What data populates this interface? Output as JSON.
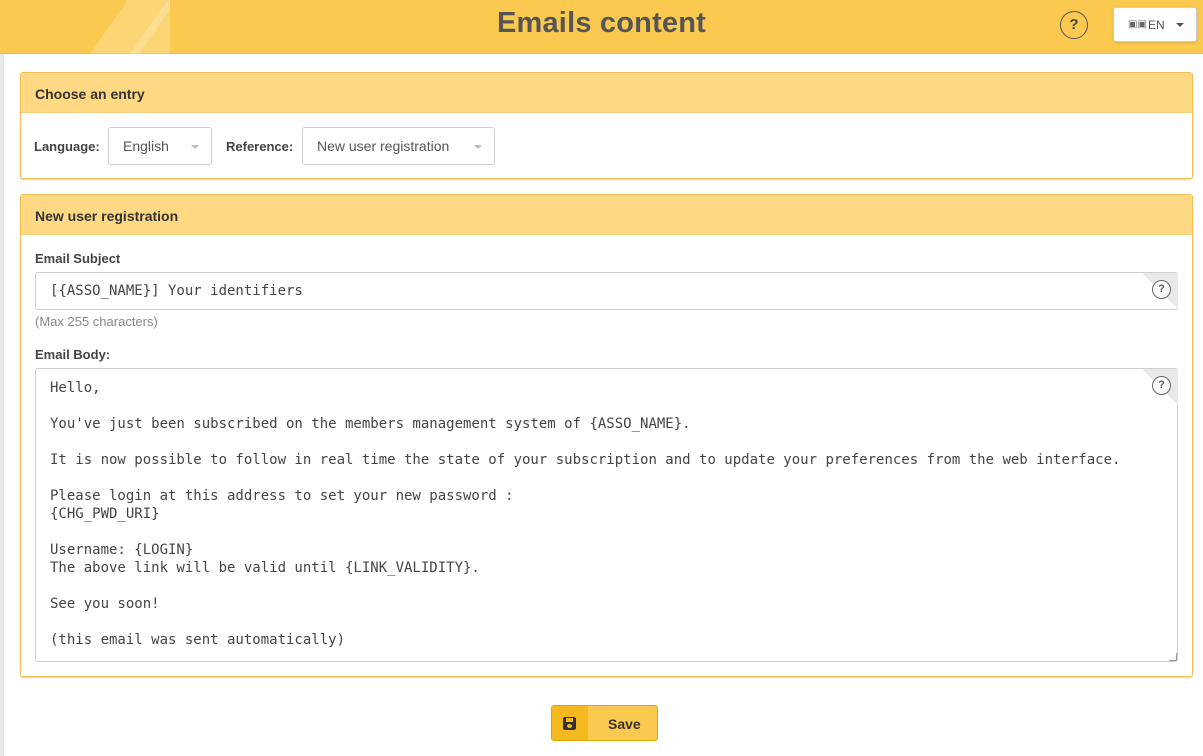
{
  "header": {
    "title": "Emails content",
    "help_label": "?",
    "language_switch": {
      "flag_icon": "flag-icon",
      "code": "EN"
    }
  },
  "choose_entry": {
    "title": "Choose an entry",
    "language_label": "Language:",
    "language_value": "English",
    "reference_label": "Reference:",
    "reference_value": "New user registration"
  },
  "editor": {
    "title": "New user registration",
    "subject_label": "Email Subject",
    "subject_value": "[{ASSO_NAME}] Your identifiers",
    "subject_hint": "(Max 255 characters)",
    "body_label": "Email Body:",
    "body_value": "Hello,\n\nYou've just been subscribed on the members management system of {ASSO_NAME}.\n\nIt is now possible to follow in real time the state of your subscription and to update your preferences from the web interface.\n\nPlease login at this address to set your new password :\n{CHG_PWD_URI}\n\nUsername: {LOGIN}\nThe above link will be valid until {LINK_VALIDITY}.\n\nSee you soon!\n\n(this email was sent automatically)",
    "help_label": "?"
  },
  "actions": {
    "save_label": "Save",
    "save_icon": "floppy-disk-icon"
  },
  "colors": {
    "topbar": "#fbc94f",
    "panel_header": "#ffd884",
    "panel_border": "#f0be55",
    "title_text": "#555555"
  }
}
